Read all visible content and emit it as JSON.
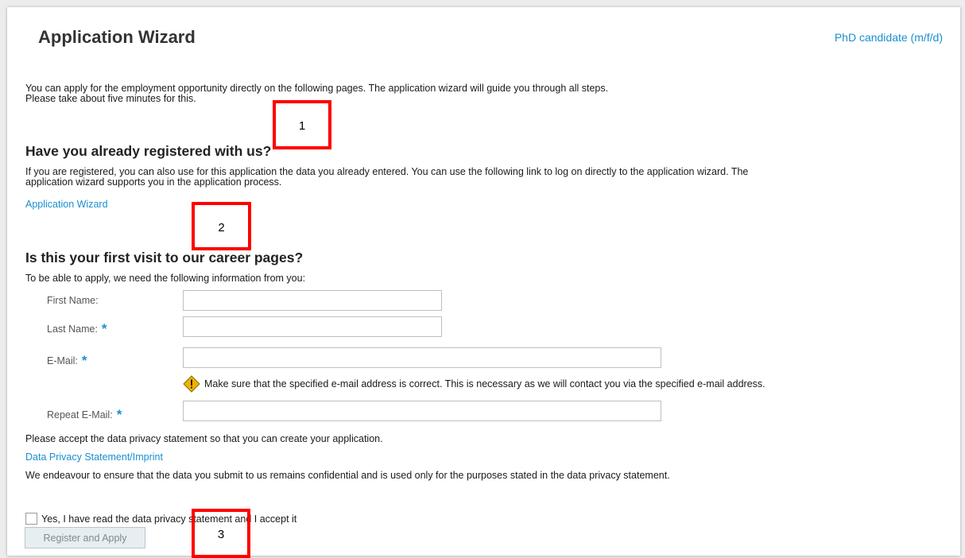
{
  "header": {
    "title": "Application Wizard",
    "job_link": "PhD candidate (m/f/d)"
  },
  "intro": {
    "line1": "You can apply for the employment opportunity directly on the following pages. The application wizard will guide you through all steps.",
    "line2": "Please take about five minutes for this."
  },
  "registered": {
    "heading": "Have you already registered with us?",
    "text1": "If you are registered, you can also use for this application the data you already entered. You can use the following link to log on directly to the application wizard. The",
    "text2": "application wizard supports you in the application process.",
    "link": "Application Wizard"
  },
  "first_visit": {
    "heading": "Is this your first visit to our career pages?",
    "subtext": "To be able to apply, we need the following information from you:"
  },
  "form": {
    "first_name_label": "First Name:",
    "last_name_label": "Last Name:",
    "email_label": "E-Mail:",
    "repeat_email_label": "Repeat E-Mail:",
    "required_marker": "*",
    "first_name_value": "",
    "last_name_value": "",
    "email_value": "",
    "repeat_email_value": "",
    "email_hint": "Make sure that the specified e-mail address is correct. This is necessary as we will contact you via the specified e-mail address."
  },
  "privacy": {
    "accept_text": "Please accept the data privacy statement so that you can create your application.",
    "link": "Data Privacy Statement/Imprint",
    "confidential_text": "We endeavour to ensure that the data you submit to us remains confidential and is used only for the purposes stated in the data privacy statement.",
    "checkbox_label": "Yes, I have read the data privacy statement and I accept it",
    "checkbox_checked": false
  },
  "submit_button": "Register and Apply",
  "annotations": [
    "1",
    "2",
    "3"
  ],
  "colors": {
    "link": "#1a8fd0",
    "annotation": "#ff0000",
    "warning": "#f2b200"
  },
  "icons": {
    "warning": "warning-diamond-icon",
    "required": "asterisk"
  }
}
